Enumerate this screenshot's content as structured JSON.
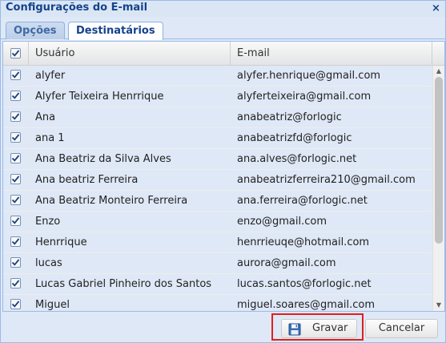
{
  "window": {
    "title": "Configurações do E-mail",
    "close_glyph": "×"
  },
  "tabs": [
    {
      "label": "Opções",
      "active": false
    },
    {
      "label": "Destinatários",
      "active": true
    }
  ],
  "grid": {
    "columns": {
      "user": "Usuário",
      "email": "E-mail"
    },
    "header_checked": true,
    "rows": [
      {
        "checked": true,
        "user": "alyfer",
        "email": "alyfer.henrique@gmail.com"
      },
      {
        "checked": true,
        "user": "Alyfer Teixeira Henrrique",
        "email": "alyferteixeira@gmail.com"
      },
      {
        "checked": true,
        "user": "Ana",
        "email": "anabeatriz@forlogic"
      },
      {
        "checked": true,
        "user": "ana 1",
        "email": "anabeatrizfd@forlogic"
      },
      {
        "checked": true,
        "user": "Ana Beatriz da Silva Alves",
        "email": "ana.alves@forlogic.net"
      },
      {
        "checked": true,
        "user": "Ana beatriz Ferreira",
        "email": "anabeatrizferreira210@gmail.com"
      },
      {
        "checked": true,
        "user": "Ana Beatriz Monteiro Ferreira",
        "email": "ana.ferreira@forlogic.net"
      },
      {
        "checked": true,
        "user": "Enzo",
        "email": "enzo@gmail.com"
      },
      {
        "checked": true,
        "user": "Henrrique",
        "email": "henrrieuqe@hotmail.com"
      },
      {
        "checked": true,
        "user": "lucas",
        "email": "aurora@gmail.com"
      },
      {
        "checked": true,
        "user": "Lucas Gabriel Pinheiro dos Santos",
        "email": "lucas.santos@forlogic.net"
      },
      {
        "checked": true,
        "user": "Miguel",
        "email": "miguel.soares@gmail.com"
      }
    ]
  },
  "scrollbar": {
    "up_glyph": "▲",
    "down_glyph": "▼"
  },
  "footer": {
    "save_label": "Gravar",
    "save_icon": "floppy-disk-icon",
    "cancel_label": "Cancelar"
  },
  "colors": {
    "title_text": "#15428b",
    "row_background": "#dfe8f6",
    "highlight_border": "#e0201c"
  }
}
